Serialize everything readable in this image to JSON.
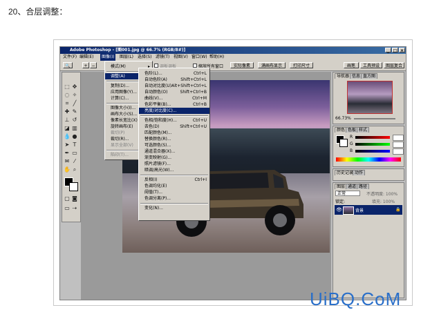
{
  "caption": "20、合层调整：",
  "app": {
    "title": "Adobe Photoshop - [图001.jpg @ 66.7% (RGB/8#)]",
    "menus": [
      "文件(F)",
      "编辑(E)",
      "图像(I)",
      "图层(L)",
      "选择(S)",
      "滤镜(T)",
      "视图(V)",
      "窗口(W)",
      "帮助(H)"
    ]
  },
  "options_bar": {
    "show_label": "显示",
    "tab_label": "调板调板",
    "all_windows": "缩放所有窗口",
    "buttons": [
      "实际像素",
      "满画布显示",
      "打印尺寸"
    ],
    "tabs": [
      "画笔",
      "工具预设",
      "图层复合"
    ]
  },
  "image_menu": {
    "items": [
      {
        "label": "模式(M)",
        "arrow": true
      },
      {
        "sep": true
      },
      {
        "label": "调整(A)",
        "arrow": true,
        "highlight": true
      },
      {
        "sep": true
      },
      {
        "label": "复制(D)..."
      },
      {
        "label": "应用图像(Y)..."
      },
      {
        "label": "计算(C)..."
      },
      {
        "sep": true
      },
      {
        "label": "图像大小(I)..."
      },
      {
        "label": "画布大小(S)..."
      },
      {
        "label": "像素长宽比(X)",
        "arrow": true
      },
      {
        "label": "旋转画布(E)",
        "arrow": true
      },
      {
        "label": "裁切(P)",
        "disabled": true
      },
      {
        "label": "裁切(R)..."
      },
      {
        "label": "显示全部(V)",
        "disabled": true
      },
      {
        "sep": true
      },
      {
        "label": "陷印(T)...",
        "disabled": true
      }
    ]
  },
  "adjust_menu": {
    "items": [
      {
        "label": "色阶(L)...",
        "shortcut": "Ctrl+L"
      },
      {
        "label": "自动色阶(A)",
        "shortcut": "Shift+Ctrl+L"
      },
      {
        "label": "自动对比度(U)",
        "shortcut": "Alt+Shift+Ctrl+L"
      },
      {
        "label": "自动颜色(O)",
        "shortcut": "Shift+Ctrl+B"
      },
      {
        "label": "曲线(V)...",
        "shortcut": "Ctrl+M"
      },
      {
        "label": "色彩平衡(B)...",
        "shortcut": "Ctrl+B"
      },
      {
        "label": "亮度/对比度(C)...",
        "shortcut": "",
        "highlight": true
      },
      {
        "sep": true
      },
      {
        "label": "色相/饱和度(H)...",
        "shortcut": "Ctrl+U"
      },
      {
        "label": "去色(D)",
        "shortcut": "Shift+Ctrl+U"
      },
      {
        "label": "匹配颜色(M)..."
      },
      {
        "label": "替换颜色(R)..."
      },
      {
        "label": "可选颜色(S)..."
      },
      {
        "label": "通道混合器(X)..."
      },
      {
        "label": "渐变映射(G)..."
      },
      {
        "label": "照片滤镜(F)..."
      },
      {
        "label": "暗调/高光(W)..."
      },
      {
        "sep": true
      },
      {
        "label": "反相(I)",
        "shortcut": "Ctrl+I"
      },
      {
        "label": "色调均化(E)"
      },
      {
        "label": "阈值(T)..."
      },
      {
        "label": "色调分离(P)..."
      },
      {
        "sep": true
      },
      {
        "label": "变化(N)..."
      }
    ]
  },
  "panels": {
    "navigator_tabs": [
      "导航器",
      "信息",
      "直方图"
    ],
    "zoom": "66.73%",
    "color_tabs": [
      "颜色",
      "色板",
      "样式"
    ],
    "color_channels": [
      "R",
      "G",
      "B"
    ],
    "history_tabs": [
      "历史记录",
      "动作"
    ],
    "layers_tabs": [
      "图层",
      "通道",
      "路径"
    ],
    "blend_mode": "正常",
    "opacity": "不透明度: 100%",
    "lock": "锁定:",
    "fill": "填充: 100%",
    "layer_name": "背景"
  },
  "watermark": "UiBQ.CoM"
}
